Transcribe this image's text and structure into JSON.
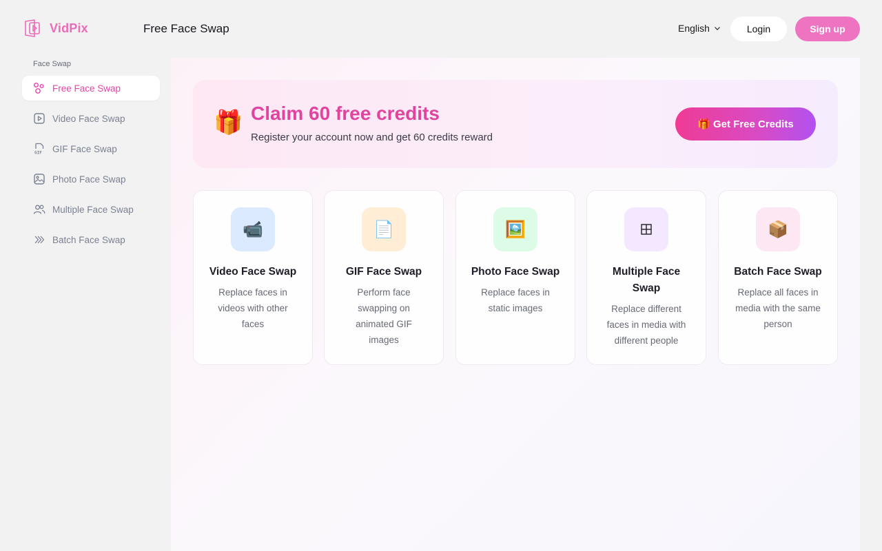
{
  "brand": {
    "name": "VidPix",
    "color": "#ec6bb8"
  },
  "header": {
    "title": "Free Face Swap",
    "language": "English",
    "login_label": "Login",
    "signup_label": "Sign up"
  },
  "sidebar": {
    "heading": "Face Swap",
    "items": [
      {
        "label": "Free Face Swap",
        "icon": "circles-icon",
        "active": true
      },
      {
        "label": "Video Face Swap",
        "icon": "video-play-icon",
        "active": false
      },
      {
        "label": "GIF Face Swap",
        "icon": "gif-file-icon",
        "active": false
      },
      {
        "label": "Photo Face Swap",
        "icon": "image-icon",
        "active": false
      },
      {
        "label": "Multiple Face Swap",
        "icon": "users-icon",
        "active": false
      },
      {
        "label": "Batch Face Swap",
        "icon": "layers-icon",
        "active": false
      }
    ]
  },
  "banner": {
    "icon": "gift-icon",
    "title": "Claim 60 free credits",
    "subtitle": "Register your account now and get 60 credits reward",
    "button_label": "Get Free Credits"
  },
  "cards": [
    {
      "title": "Video Face Swap",
      "description": "Replace faces in videos with other faces",
      "icon": "video-camera-icon",
      "icon_bg": "#dbeafe"
    },
    {
      "title": "GIF Face Swap",
      "description": "Perform face swapping on animated GIF images",
      "icon": "document-icon",
      "icon_bg": "#ffedd5"
    },
    {
      "title": "Photo Face Swap",
      "description": "Replace faces in static images",
      "icon": "framed-picture-icon",
      "icon_bg": "#dcfce7"
    },
    {
      "title": "Multiple Face Swap",
      "description": "Replace different faces in media with different people",
      "icon": "grid-icon",
      "icon_bg": "#f3e8ff"
    },
    {
      "title": "Batch Face Swap",
      "description": "Replace all faces in media with the same person",
      "icon": "package-icon",
      "icon_bg": "#fce7f3"
    }
  ]
}
